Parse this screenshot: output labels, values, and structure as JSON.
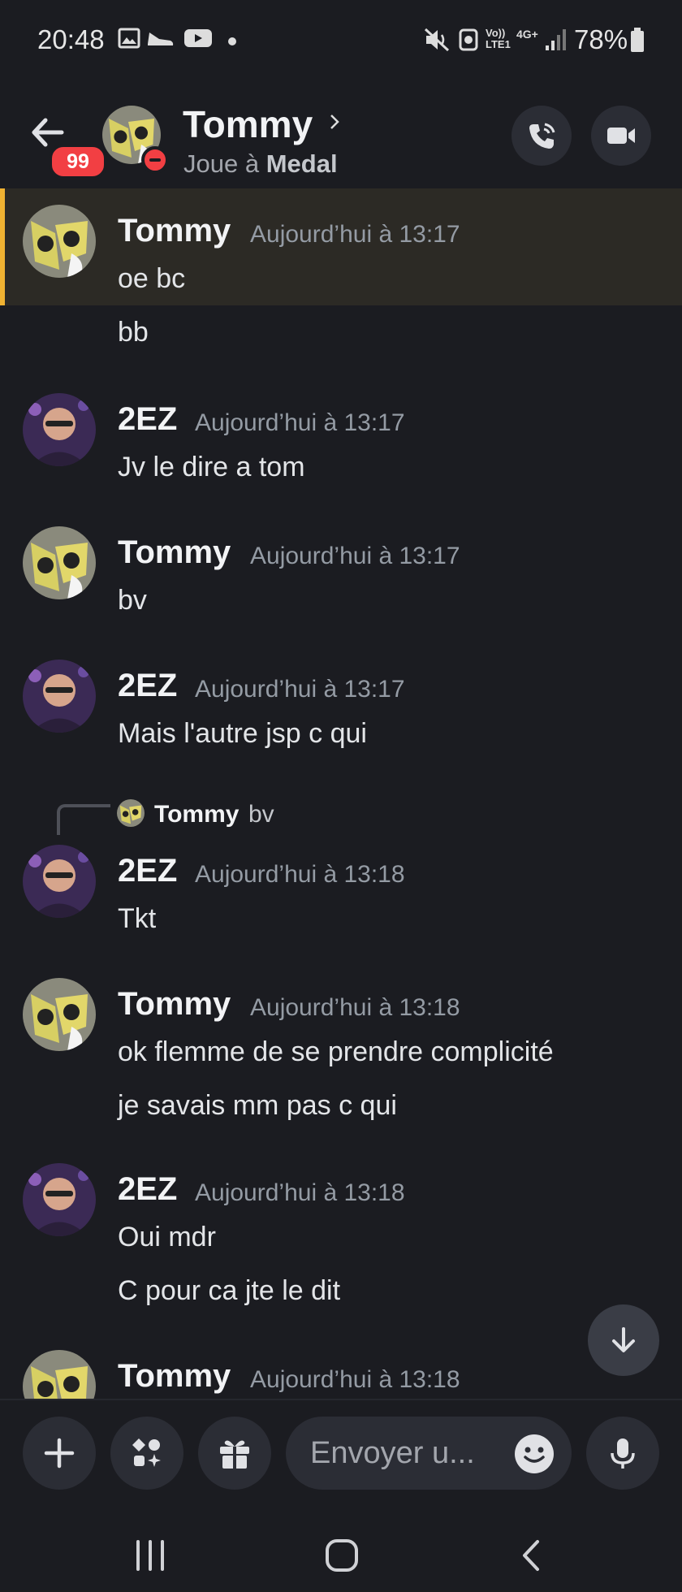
{
  "status_bar": {
    "time": "20:48",
    "battery_percent": "78%",
    "network_labels": [
      "Vo)) LTE1",
      "4G+"
    ]
  },
  "header": {
    "unread_badge": "99",
    "contact_name": "Tommy",
    "status_prefix": "Joue à",
    "status_game": "Medal"
  },
  "messages": [
    {
      "author": "Tommy",
      "timestamp": "Aujourd’hui à 13:17",
      "lines": [
        "oe bc",
        "bb"
      ],
      "highlighted": true
    },
    {
      "author": "2EZ",
      "timestamp": "Aujourd’hui à 13:17",
      "lines": [
        "Jv le dire a tom"
      ]
    },
    {
      "author": "Tommy",
      "timestamp": "Aujourd’hui à 13:17",
      "lines": [
        "bv"
      ]
    },
    {
      "author": "2EZ",
      "timestamp": "Aujourd’hui à 13:17",
      "lines": [
        "Mais l'autre jsp c qui"
      ]
    },
    {
      "author": "2EZ",
      "timestamp": "Aujourd’hui à 13:18",
      "lines": [
        "Tkt"
      ],
      "reply_to": {
        "author": "Tommy",
        "text": "bv"
      }
    },
    {
      "author": "Tommy",
      "timestamp": "Aujourd’hui à 13:18",
      "lines": [
        "ok flemme de se prendre complicité",
        "je savais mm pas c qui"
      ]
    },
    {
      "author": "2EZ",
      "timestamp": "Aujourd’hui à 13:18",
      "lines": [
        "Oui mdr",
        "C pour ca jte le dit"
      ]
    },
    {
      "author": "Tommy",
      "timestamp": "Aujourd’hui à 13:18",
      "lines": []
    }
  ],
  "composer": {
    "placeholder": "Envoyer u..."
  },
  "colors": {
    "background": "#1b1c21",
    "highlight": "#2c2a25",
    "highlight_accent": "#f0b232",
    "badge": "#f23f43",
    "timestamp": "#949ba4"
  },
  "icons": [
    "back-arrow-icon",
    "phone-call-icon",
    "video-camera-icon",
    "plus-icon",
    "apps-icon",
    "gift-icon",
    "emoji-icon",
    "microphone-icon",
    "arrow-down-icon",
    "recents-icon",
    "home-icon",
    "back-icon"
  ]
}
